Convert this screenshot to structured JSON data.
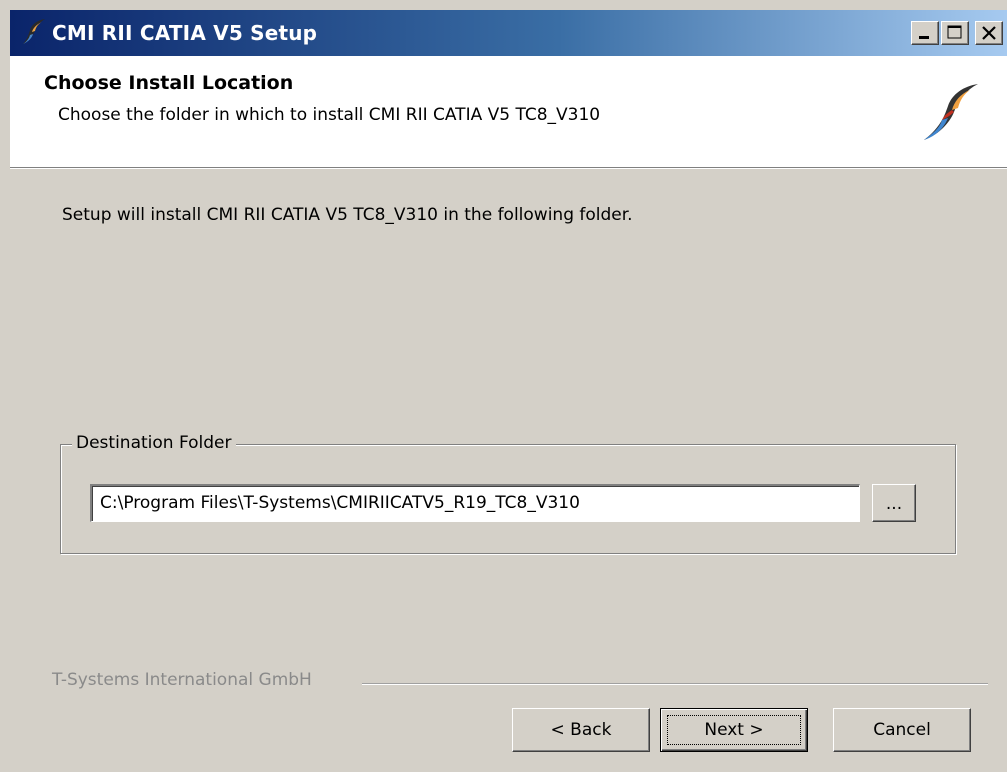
{
  "window": {
    "title": "CMI RII CATIA V5  Setup",
    "controls": {
      "minimize": "minimize",
      "maximize": "maximize",
      "close": "close"
    }
  },
  "header": {
    "title": "Choose Install Location",
    "subtitle": "Choose the folder in which to install CMI RII CATIA V5 TC8_V310"
  },
  "main": {
    "description": "Setup will install CMI RII CATIA V5 TC8_V310 in the following folder.",
    "destination_group": {
      "label": "Destination Folder",
      "path": "C:\\Program Files\\T-Systems\\CMIRIICATV5_R19_TC8_V310",
      "browse_label": "..."
    }
  },
  "footer": {
    "brand": "T-Systems International GmbH",
    "back_label": "< Back",
    "next_label": "Next >",
    "cancel_label": "Cancel"
  },
  "icons": {
    "app": "swoosh-logo-icon",
    "header_logo": "swoosh-logo-icon"
  },
  "colors": {
    "titlebar_start": "#0a246a",
    "titlebar_end": "#a6caf0",
    "dialog_bg": "#d4d0c8",
    "brand_text": "#8a8a8a"
  }
}
